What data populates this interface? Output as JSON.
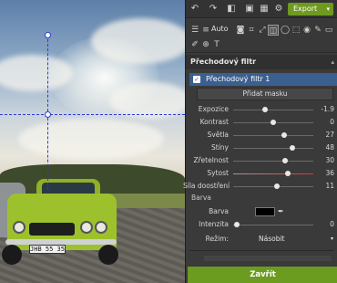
{
  "toolbar_top": {
    "export_label": "Export",
    "export_caret": "▾",
    "icons": [
      "undo-icon",
      "redo-icon",
      "image-icon",
      "gallery-icon",
      "settings-icon"
    ]
  },
  "tools": {
    "auto_label": "Auto"
  },
  "section": {
    "title": "Přechodový filtr",
    "collapse_arrow": "▴"
  },
  "filter": {
    "item_label": "Přechodový filtr 1",
    "check": "✓",
    "add_mask_label": "Přidat masku"
  },
  "sliders": [
    {
      "label": "Expozice",
      "value": "-1.9",
      "level": 0.4
    },
    {
      "label": "Kontrast",
      "value": "0",
      "level": 0.5
    },
    {
      "label": "Světla",
      "value": "27",
      "level": 0.64
    },
    {
      "label": "Stíny",
      "value": "48",
      "level": 0.74
    },
    {
      "label": "Zřetelnost",
      "value": "30",
      "level": 0.65
    },
    {
      "label": "Sytost",
      "value": "36",
      "level": 0.68
    },
    {
      "label": "Síla doostření",
      "value": "11",
      "level": 0.55
    }
  ],
  "color_section": {
    "heading": "Barva",
    "color_label": "Barva",
    "color_value": "#000000",
    "intensity_label": "Intenzita",
    "intensity_value": "0",
    "intensity_level": 0.05,
    "mode_label": "Režim:",
    "mode_value": "Násobit"
  },
  "apply_label": "Zavřít",
  "photo": {
    "plate_text": "JHB 55 35"
  },
  "colors": {
    "accent_green": "#6b9b1f",
    "selected_blue": "#3b5f8f",
    "guide_blue": "#2d3bd0"
  }
}
